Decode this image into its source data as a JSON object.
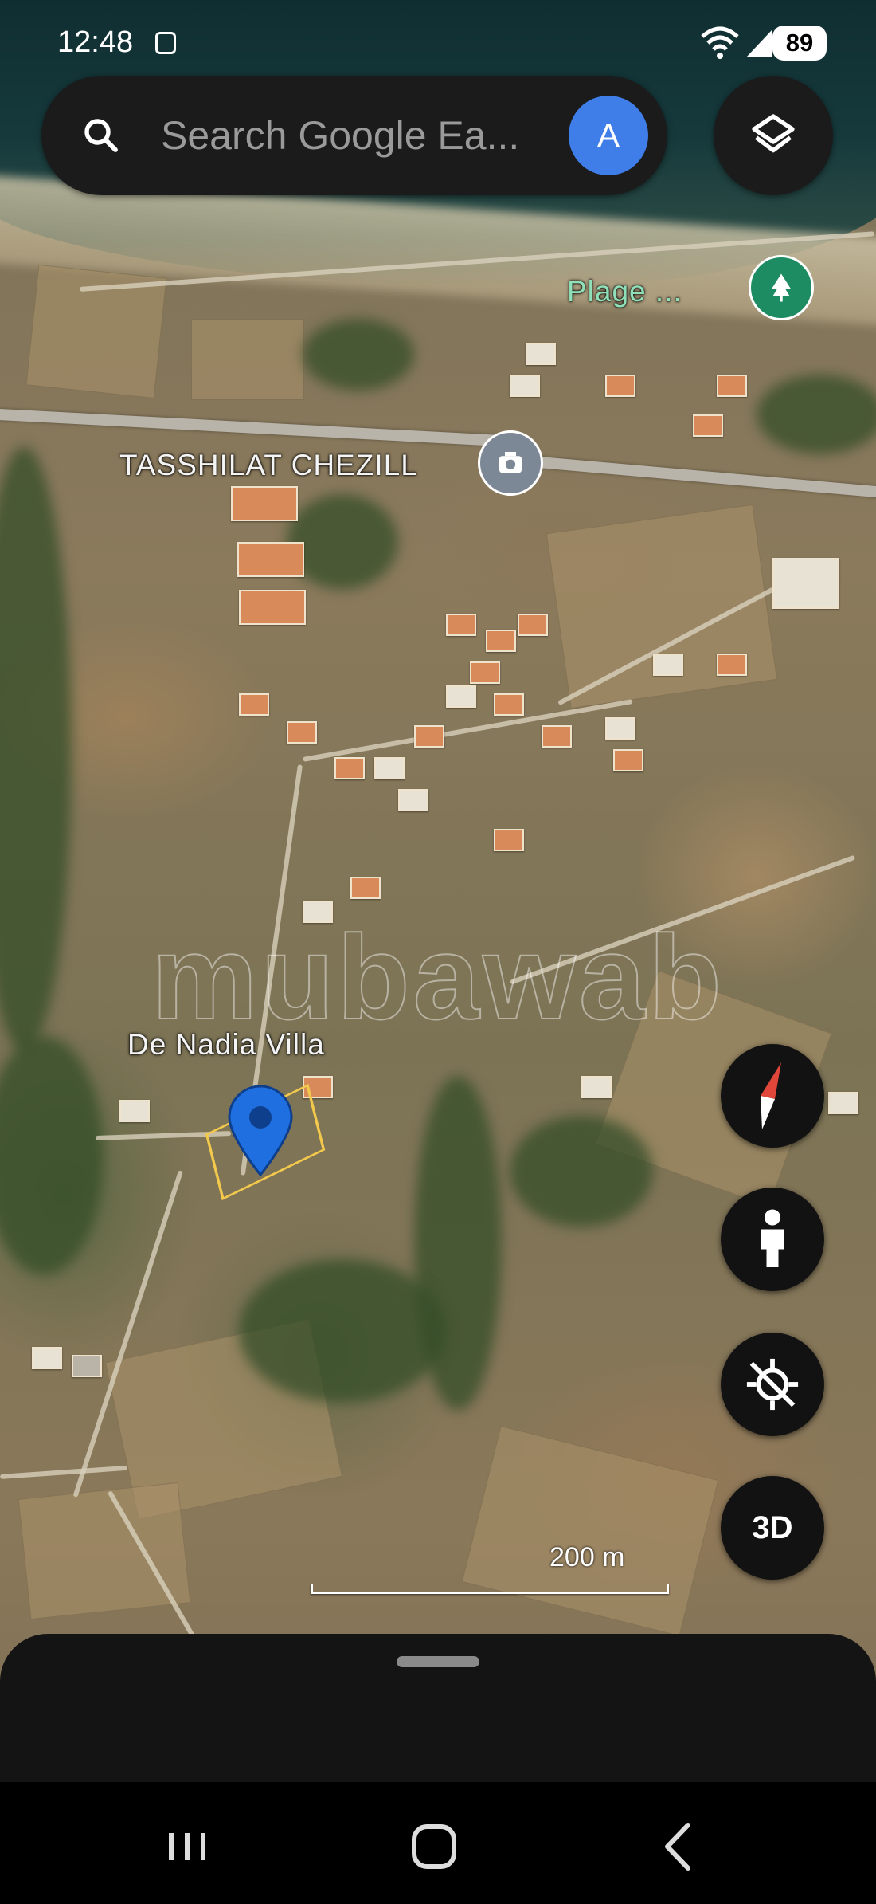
{
  "status_bar": {
    "time": "12:48",
    "battery": "89",
    "icons": [
      "notification-icon",
      "wifi-icon",
      "signal-icon"
    ]
  },
  "search": {
    "placeholder": "Search Google Ea...",
    "avatar_letter": "A",
    "icon": "search-icon",
    "layers_icon": "layers-icon"
  },
  "map": {
    "labels": {
      "beach": "Plage ...",
      "place_tasshilat": "TASSHILAT CHEZILL",
      "villa": "De Nadia Villa"
    },
    "watermark": "mubawab",
    "scale": "200 m",
    "icons": {
      "beach_marker": "tree-icon",
      "shop_marker": "shop-icon",
      "location_pin": "location-pin-icon"
    }
  },
  "controls": {
    "compass": "compass-icon",
    "street_view": "pegman-icon",
    "locate": "locate-off-icon",
    "view_3d_label": "3D"
  },
  "nav": [
    "recents-icon",
    "home-icon",
    "back-icon"
  ],
  "colors": {
    "accent_blue": "#3f7de8",
    "pin_blue": "#1f6fe0",
    "beach_green": "#1e8c62",
    "parcel_outline": "#f2c94c",
    "surface": "#1b1b1b"
  }
}
